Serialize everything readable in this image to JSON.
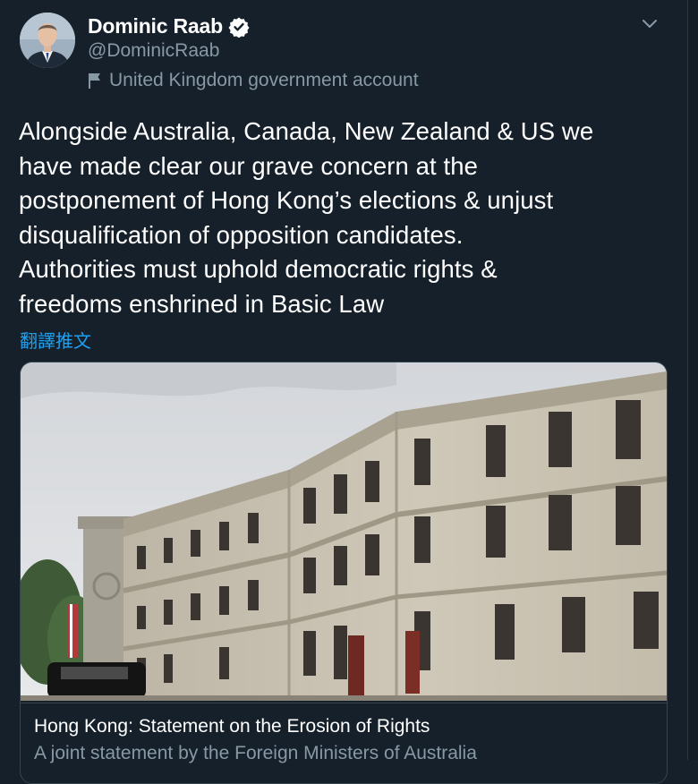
{
  "author": {
    "name": "Dominic Raab",
    "handle": "@DominicRaab",
    "label": "United Kingdom government account",
    "verified": true
  },
  "tweet": {
    "text": "Alongside Australia, Canada, New Zealand & US we\nhave made clear our grave concern at the\npostponement of Hong Kong’s elections & unjust\ndisqualification of opposition candidates.\nAuthorities must uphold democratic rights &\nfreedoms enshrined in Basic Law",
    "translate_label": "翻譯推文"
  },
  "card": {
    "title": "Hong Kong: Statement on the Erosion of Rights",
    "description": "A joint statement by the Foreign Ministers of Australia"
  },
  "icons": {
    "verified": "verified-badge-icon",
    "label": "flag-icon",
    "menu": "chevron-down-icon"
  },
  "colors": {
    "background": "#15202b",
    "accent": "#1da1f2",
    "secondary_text": "#8899a6",
    "border": "#38444d"
  }
}
